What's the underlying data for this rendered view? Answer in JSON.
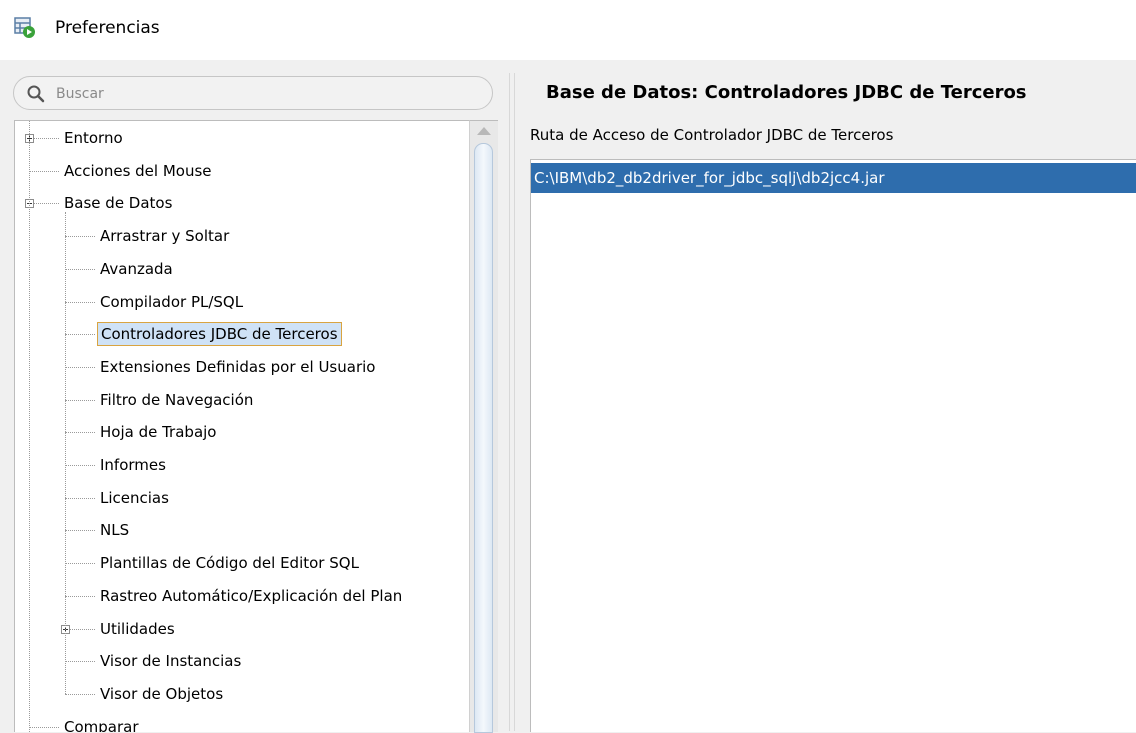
{
  "window": {
    "title": "Preferencias",
    "icon": "preferences-icon"
  },
  "search": {
    "placeholder": "Buscar"
  },
  "tree": {
    "items": [
      {
        "label": "Entorno",
        "level": 0,
        "expander": "plus"
      },
      {
        "label": "Acciones del Mouse",
        "level": 0
      },
      {
        "label": "Base de Datos",
        "level": 0,
        "expander": "minus"
      },
      {
        "label": "Arrastrar y Soltar",
        "level": 1
      },
      {
        "label": "Avanzada",
        "level": 1
      },
      {
        "label": "Compilador PL/SQL",
        "level": 1
      },
      {
        "label": "Controladores JDBC de Terceros",
        "level": 1,
        "selected": true
      },
      {
        "label": "Extensiones Definidas por el Usuario",
        "level": 1
      },
      {
        "label": "Filtro de Navegación",
        "level": 1
      },
      {
        "label": "Hoja de Trabajo",
        "level": 1
      },
      {
        "label": "Informes",
        "level": 1
      },
      {
        "label": "Licencias",
        "level": 1
      },
      {
        "label": "NLS",
        "level": 1
      },
      {
        "label": "Plantillas de Código del Editor SQL",
        "level": 1
      },
      {
        "label": "Rastreo Automático/Explicación del Plan",
        "level": 1
      },
      {
        "label": "Utilidades",
        "level": 1,
        "expander": "plus"
      },
      {
        "label": "Visor de Instancias",
        "level": 1
      },
      {
        "label": "Visor de Objetos",
        "level": 1
      },
      {
        "label": "Comparar",
        "level": 0
      }
    ]
  },
  "content": {
    "title": "Base de Datos: Controladores JDBC de Terceros",
    "path_label": "Ruta de Acceso de Controlador JDBC de Terceros",
    "paths": [
      "C:\\IBM\\db2_db2driver_for_jdbc_sqlj\\db2jcc4.jar"
    ]
  },
  "colors": {
    "selection_bg": "#2e6dad",
    "tree_selected_border": "#d9a441",
    "tree_selected_bg": "#cfe2f6"
  }
}
